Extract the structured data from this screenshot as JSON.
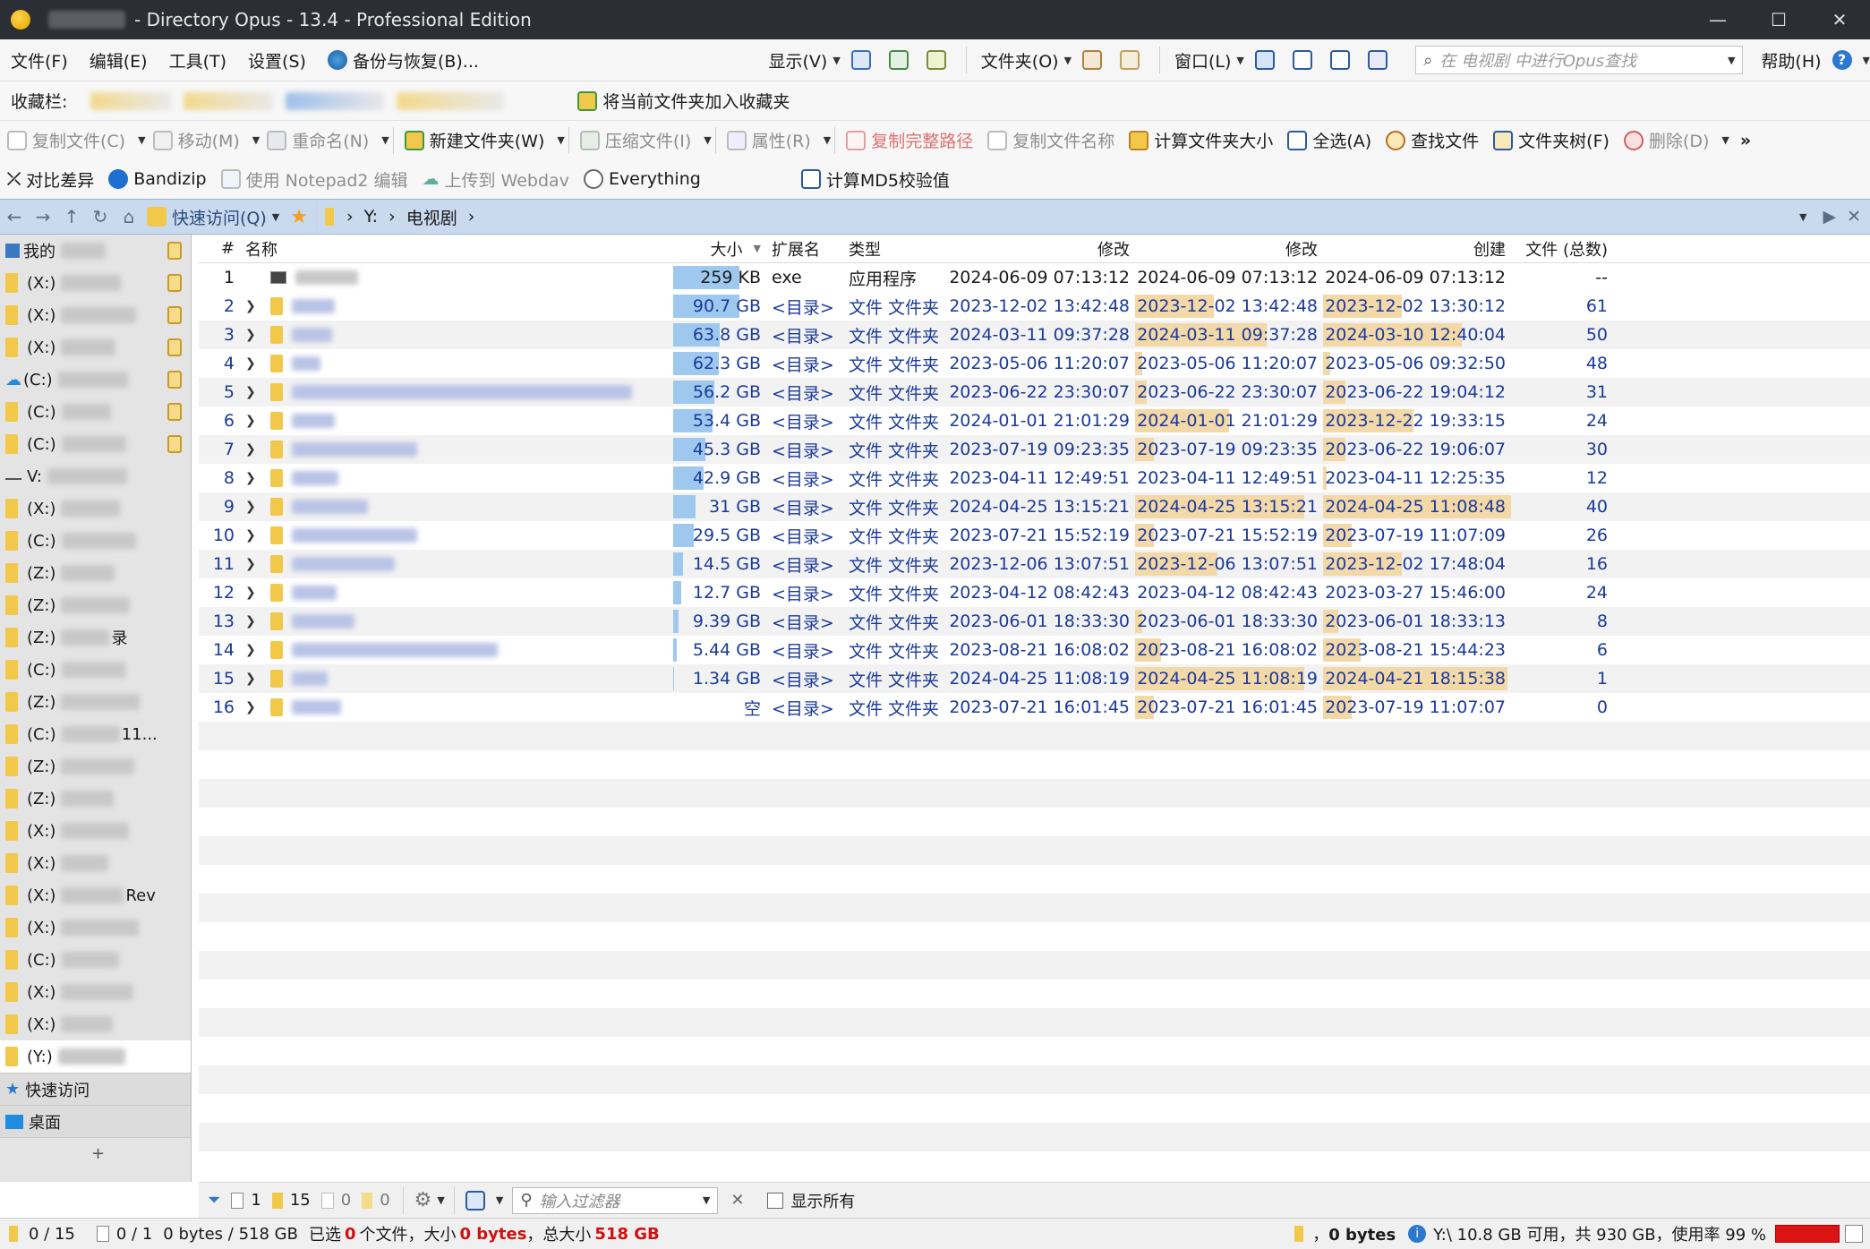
{
  "window": {
    "title": "- Directory Opus - 13.4 - Professional Edition",
    "minimize": "—",
    "maximize": "☐",
    "close": "✕"
  },
  "menu": {
    "file": "文件(F)",
    "edit": "编辑(E)",
    "tools": "工具(T)",
    "settings": "设置(S)",
    "backup": "备份与恢复(B)...",
    "display": "显示(V)",
    "folder": "文件夹(O)",
    "window": "窗口(L)",
    "search_placeholder": "在 电视剧 中进行Opus查找",
    "help": "帮助(H)"
  },
  "favbar": {
    "label": "收藏栏:",
    "add_label": "将当前文件夹加入收藏夹"
  },
  "toolbar1": {
    "copy": "复制文件(C)",
    "move": "移动(M)",
    "rename": "重命名(N)",
    "new_folder": "新建文件夹(W)",
    "compress": "压缩文件(I)",
    "properties": "属性(R)",
    "copy_path": "复制完整路径",
    "copy_name": "复制文件名称",
    "calc_size": "计算文件夹大小",
    "select_all": "全选(A)",
    "find": "查找文件",
    "tree": "文件夹树(F)",
    "delete": "删除(D)"
  },
  "toolbar2": {
    "diff": "对比差异",
    "bandizip": "Bandizip",
    "notepad": "使用 Notepad2 编辑",
    "webdav": "上传到 Webdav",
    "everything": "Everything",
    "md5": "计算MD5校验值"
  },
  "path": {
    "quick_access": "快速访问(Q)",
    "drive": "Y:",
    "folder": "电视剧"
  },
  "sidebar": {
    "items": [
      {
        "label": "我的",
        "lock": true
      },
      {
        "label": "(X:)",
        "lock": true
      },
      {
        "label": "(X:)",
        "lock": true
      },
      {
        "label": "(X:)",
        "lock": true
      },
      {
        "label": "(C:)",
        "lock": true,
        "cloud": true
      },
      {
        "label": "(C:)",
        "lock": true
      },
      {
        "label": "(C:)",
        "lock": true
      },
      {
        "label": "V:",
        "lock": false,
        "drive": true
      },
      {
        "label": "(X:)"
      },
      {
        "label": "(C:)"
      },
      {
        "label": "(Z:)"
      },
      {
        "label": "(Z:)"
      },
      {
        "label": "(Z:)",
        "suffix": "录"
      },
      {
        "label": "(C:)"
      },
      {
        "label": "(Z:)"
      },
      {
        "label": "(C:)",
        "suffix": "11..."
      },
      {
        "label": "(Z:)"
      },
      {
        "label": "(Z:)"
      },
      {
        "label": "(X:)"
      },
      {
        "label": "(X:)"
      },
      {
        "label": "(X:)",
        "suffix": "Rev"
      },
      {
        "label": "(X:)"
      },
      {
        "label": "(C:)"
      },
      {
        "label": "(X:)"
      },
      {
        "label": "(X:)"
      },
      {
        "label": "(Y:)",
        "selected": true
      }
    ],
    "quick_access": "快速访问",
    "desktop": "桌面",
    "add": "+"
  },
  "columns": {
    "num": "#",
    "name": "名称",
    "size": "大小",
    "ext": "扩展名",
    "type": "类型",
    "mod1": "修改",
    "mod2": "修改",
    "created": "创建",
    "count": "文件 (总数)"
  },
  "rows": [
    {
      "num": "1",
      "size": "259 KB",
      "sizefrac": 0.71,
      "ext": "exe",
      "type": "应用程序",
      "mod1": "2024-06-09 07:13:12",
      "mod2": "2024-06-09  07:13:12",
      "modfrac": 0.0,
      "created": "2024-06-09  07:13:12",
      "crefrac": 0.0,
      "count": "--",
      "exe": true
    },
    {
      "num": "2",
      "size": "90.7 GB",
      "sizefrac": 0.71,
      "ext": "<目录>",
      "type": "文件 文件夹",
      "mod1": "2023-12-02 13:42:48",
      "mod2": "2023-12-02 13:42:48",
      "modfrac": 0.42,
      "created": "2023-12-02 13:30:12",
      "crefrac": 0.42,
      "count": "61"
    },
    {
      "num": "3",
      "size": "63.8 GB",
      "sizefrac": 0.5,
      "ext": "<目录>",
      "type": "文件 文件夹",
      "mod1": "2024-03-11 09:37:28",
      "mod2": "2024-03-11 09:37:28",
      "modfrac": 0.7,
      "created": "2024-03-10 12:40:04",
      "crefrac": 0.74,
      "count": "50"
    },
    {
      "num": "4",
      "size": "62.3 GB",
      "sizefrac": 0.49,
      "ext": "<目录>",
      "type": "文件 文件夹",
      "mod1": "2023-05-06 11:20:07",
      "mod2": "2023-05-06  11:20:07",
      "modfrac": 0.04,
      "created": "2023-05-06  09:32:50",
      "crefrac": 0.04,
      "count": "48"
    },
    {
      "num": "5",
      "size": "56.2 GB",
      "sizefrac": 0.44,
      "ext": "<目录>",
      "type": "文件 文件夹",
      "mod1": "2023-06-22 23:30:07",
      "mod2": "2023-06-22  23:30:07",
      "modfrac": 0.06,
      "created": "2023-06-22  19:04:12",
      "crefrac": 0.12,
      "count": "31"
    },
    {
      "num": "6",
      "size": "53.4 GB",
      "sizefrac": 0.42,
      "ext": "<目录>",
      "type": "文件 文件夹",
      "mod1": "2024-01-01 21:01:29",
      "mod2": "2024-01-01 21:01:29",
      "modfrac": 0.5,
      "created": "2023-12-22 19:33:15",
      "crefrac": 0.48,
      "count": "24"
    },
    {
      "num": "7",
      "size": "45.3 GB",
      "sizefrac": 0.35,
      "ext": "<目录>",
      "type": "文件 文件夹",
      "mod1": "2023-07-19 09:23:35",
      "mod2": "2023-07-19  09:23:35",
      "modfrac": 0.1,
      "created": "2023-06-22  19:06:07",
      "crefrac": 0.12,
      "count": "30"
    },
    {
      "num": "8",
      "size": "42.9 GB",
      "sizefrac": 0.33,
      "ext": "<目录>",
      "type": "文件 文件夹",
      "mod1": "2023-04-11 12:49:51",
      "mod2": "2023-04-11  12:49:51",
      "modfrac": 0.0,
      "created": "2023-04-11  12:25:35",
      "crefrac": 0.02,
      "count": "12"
    },
    {
      "num": "9",
      "size": "31 GB",
      "sizefrac": 0.24,
      "ext": "<目录>",
      "type": "文件 文件夹",
      "mod1": "2024-04-25 13:15:21",
      "mod2": "2024-04-25 13:15:21",
      "modfrac": 0.9,
      "created": "2024-04-25 11:08:48",
      "crefrac": 1.0,
      "count": "40"
    },
    {
      "num": "10",
      "size": "29.5 GB",
      "sizefrac": 0.22,
      "ext": "<目录>",
      "type": "文件 文件夹",
      "mod1": "2023-07-21 15:52:19",
      "mod2": "2023-07-21  15:52:19",
      "modfrac": 0.1,
      "created": "2023-07-19  11:07:09",
      "crefrac": 0.15,
      "count": "26"
    },
    {
      "num": "11",
      "size": "14.5 GB",
      "sizefrac": 0.11,
      "ext": "<目录>",
      "type": "文件 文件夹",
      "mod1": "2023-12-06 13:07:51",
      "mod2": "2023-12-06 13:07:51",
      "modfrac": 0.44,
      "created": "2023-12-02 17:48:04",
      "crefrac": 0.42,
      "count": "16"
    },
    {
      "num": "12",
      "size": "12.7 GB",
      "sizefrac": 0.09,
      "ext": "<目录>",
      "type": "文件 文件夹",
      "mod1": "2023-04-12 08:42:43",
      "mod2": "2023-04-12  08:42:43",
      "modfrac": 0.0,
      "created": "2023-03-27  15:46:00",
      "crefrac": 0.0,
      "count": "24"
    },
    {
      "num": "13",
      "size": "9.39 GB",
      "sizefrac": 0.06,
      "ext": "<目录>",
      "type": "文件 文件夹",
      "mod1": "2023-06-01 18:33:30",
      "mod2": "2023-06-01  18:33:30",
      "modfrac": 0.04,
      "created": "2023-06-01  18:33:13",
      "crefrac": 0.08,
      "count": "8"
    },
    {
      "num": "14",
      "size": "5.44 GB",
      "sizefrac": 0.04,
      "ext": "<目录>",
      "type": "文件 文件夹",
      "mod1": "2023-08-21 16:08:02",
      "mod2": "2023-08-21  16:08:02",
      "modfrac": 0.14,
      "created": "2023-08-21  15:44:23",
      "crefrac": 0.2,
      "count": "6"
    },
    {
      "num": "15",
      "size": "1.34 GB",
      "sizefrac": 0.01,
      "ext": "<目录>",
      "type": "文件 文件夹",
      "mod1": "2024-04-25 11:08:19",
      "mod2": "2024-04-25 11:08:19",
      "modfrac": 0.9,
      "created": "2024-04-21 18:15:38",
      "crefrac": 0.98,
      "count": "1"
    },
    {
      "num": "16",
      "size": "空",
      "sizefrac": 0.0,
      "ext": "<目录>",
      "type": "文件 文件夹",
      "mod1": "2023-07-21 16:01:45",
      "mod2": "2023-07-21  16:01:45",
      "modfrac": 0.1,
      "created": "2023-07-19  11:07:07",
      "crefrac": 0.15,
      "count": "0"
    }
  ],
  "status1": {
    "files": "1",
    "folders": "15",
    "c1": "0",
    "c2": "0",
    "filter_placeholder": "输入过滤器",
    "show_all": "显示所有"
  },
  "status2": {
    "sel_folders": "0 / 15",
    "sel_files": "0 / 1",
    "bytes": "0 bytes / 518 GB",
    "sel_prefix": "已选",
    "sel_count": "0",
    "sel_mid": "个文件，大小",
    "sel_size": "0 bytes",
    "sel_total_lbl": "，总大小",
    "sel_total": "518 GB",
    "right_bytes": "0 bytes",
    "drive_info": "Y:\\ 10.8 GB 可用，共 930 GB，使用率 99 %"
  },
  "colors": {
    "accent": "#2b2e34",
    "size_bar": "#9ec8ee",
    "age_bar": "#f3d8a8",
    "path_bg": "#c9d9ee",
    "usage_red": "#dc1414"
  }
}
